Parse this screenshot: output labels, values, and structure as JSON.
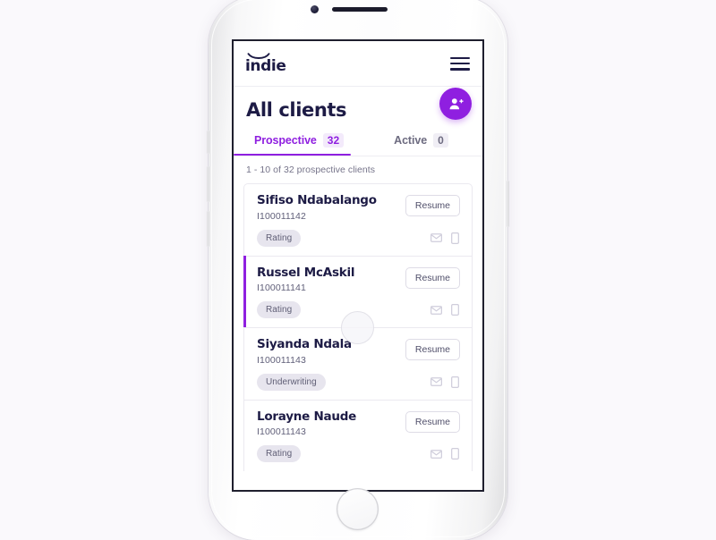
{
  "device": {
    "camera": "camera-dot",
    "speaker": "speaker-grille",
    "home_button": "home-button"
  },
  "appbar": {
    "logo_text": "indie",
    "logo_icon": "indie-smile-arc",
    "menu_icon": "hamburger-menu-icon"
  },
  "header": {
    "title": "All clients",
    "fab_icon": "add-user-icon",
    "fab_color": "#8f1fe0"
  },
  "tabs": [
    {
      "label": "Prospective",
      "count": "32",
      "active": true
    },
    {
      "label": "Active",
      "count": "0",
      "active": false
    }
  ],
  "list": {
    "summary": "1 - 10 of 32 prospective clients",
    "resume_label": "Resume",
    "email_icon": "envelope-icon",
    "phone_icon": "mobile-phone-icon",
    "clients": [
      {
        "name": "Sifiso Ndabalango",
        "id": "I100011142",
        "status": "Rating",
        "selected": false
      },
      {
        "name": "Russel McAskil",
        "id": "I100011141",
        "status": "Rating",
        "selected": true
      },
      {
        "name": "Siyanda Ndala",
        "id": "I100011143",
        "status": "Underwriting",
        "selected": false
      },
      {
        "name": "Lorayne Naude",
        "id": "I100011143",
        "status": "Rating",
        "selected": false
      }
    ]
  },
  "colors": {
    "accent": "#8f1fe0",
    "text_dark": "#1d1b45",
    "page_bg": "#faf9fc"
  }
}
